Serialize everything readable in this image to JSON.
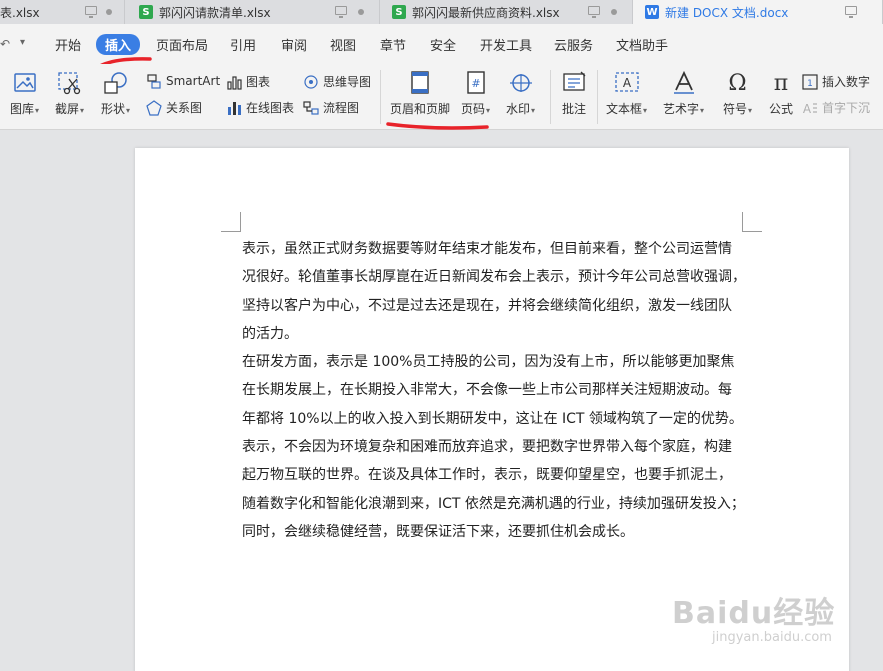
{
  "tabs": [
    {
      "label": "表.xlsx",
      "type": "s"
    },
    {
      "label": "郭闪闪请款清单.xlsx",
      "type": "s"
    },
    {
      "label": "郭闪闪最新供应商资料.xlsx",
      "type": "s"
    },
    {
      "label": "新建 DOCX 文档.docx",
      "type": "w"
    }
  ],
  "menu": [
    "开始",
    "插入",
    "页面布局",
    "引用",
    "审阅",
    "视图",
    "章节",
    "安全",
    "开发工具",
    "云服务",
    "文档助手"
  ],
  "active_menu": "插入",
  "ribbon": {
    "picture": "图库",
    "screenshot": "截屏",
    "shape": "形状",
    "smartart": "SmartArt",
    "chart": "图表",
    "mindmap": "思维导图",
    "relation": "关系图",
    "online_chart": "在线图表",
    "flowchart": "流程图",
    "header_footer": "页眉和页脚",
    "page_number": "页码",
    "watermark": "水印",
    "annotation": "批注",
    "textbox": "文本框",
    "wordart": "艺术字",
    "symbol": "符号",
    "formula": "公式",
    "insert_number": "插入数字",
    "drop_cap": "首字下沉"
  },
  "document": {
    "lines": [
      "表示，虽然正式财务数据要等财年结束才能发布，但目前来看，整个公司运营情",
      "况很好。轮值董事长胡厚崑在近日新闻发布会上表示，预计今年公司总营收强调，",
      "坚持以客户为中心，不过是过去还是现在，并将会继续简化组织，激发一线团队",
      "的活力。",
      "在研发方面，表示是 100%员工持股的公司，因为没有上市，所以能够更加聚焦",
      "在长期发展上，在长期投入非常大，不会像一些上市公司那样关注短期波动。每",
      "年都将 10%以上的收入投入到长期研发中，这让在 ICT 领域构筑了一定的优势。",
      "表示，不会因为环境复杂和困难而放弃追求，要把数字世界带入每个家庭，构建",
      "起万物互联的世界。在谈及具体工作时，表示，既要仰望星空，也要手抓泥土，",
      "随着数字化和智能化浪潮到来，ICT 依然是充满机遇的行业，持续加强研发投入；",
      "同时，会继续稳健经营，既要保证活下来，还要抓住机会成长。"
    ]
  },
  "watermark": {
    "main": "Baidu经验",
    "sub": "jingyan.baidu.com"
  },
  "colors": {
    "accent": "#3a7ee4",
    "annotation": "#e8232a",
    "sheet": "#2fa84f",
    "doc": "#2f7ae5"
  }
}
